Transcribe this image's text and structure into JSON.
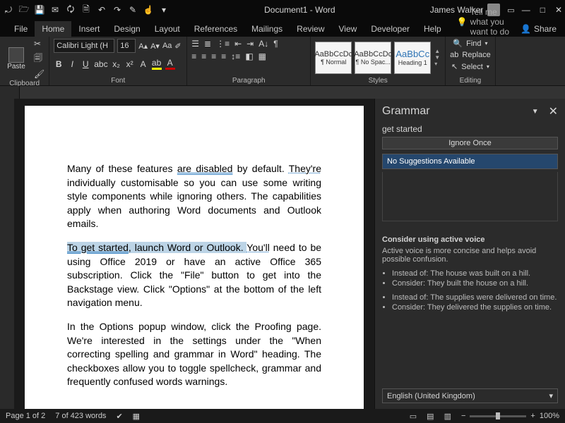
{
  "title": "Document1 - Word",
  "user": "James Walker",
  "tabs": [
    "File",
    "Home",
    "Insert",
    "Design",
    "Layout",
    "References",
    "Mailings",
    "Review",
    "View",
    "Developer",
    "Help"
  ],
  "active_tab": "Home",
  "tell_me": "Tell me what you want to do",
  "share": "Share",
  "ribbon": {
    "clipboard": {
      "paste": "Paste",
      "label": "Clipboard"
    },
    "font": {
      "name": "Calibri Light (H",
      "size": "16",
      "label": "Font"
    },
    "paragraph": {
      "label": "Paragraph"
    },
    "styles": {
      "label": "Styles",
      "s1_sample": "AaBbCcDc",
      "s1_name": "¶ Normal",
      "s2_sample": "AaBbCcDc",
      "s2_name": "¶ No Spac...",
      "s3_sample": "AaBbCc",
      "s3_name": "Heading 1"
    },
    "editing": {
      "find": "Find",
      "replace": "Replace",
      "select": "Select",
      "label": "Editing"
    }
  },
  "doc": {
    "p1a": "Many of these features ",
    "p1b": "are disabled",
    "p1c": " by default. ",
    "p1d": "They're",
    "p1e": " individually customisable so you can use some writing style components while ignoring others. The capabilities apply when authoring Word documents and Outlook emails.",
    "p2a": "To get started",
    "p2b": ", launch Word or Outlook. ",
    "p2c": "You'll",
    "p2d": " need to be using Office 2019 or have an active Office 365 subscription. Click the \"File\" button to get into the Backstage view. Click \"Options\" at the bottom of the left navigation menu.",
    "p3": "In the Options popup window, click the Proofing page. We're interested in the settings under the \"When correcting spelling and grammar in Word\" heading. The checkboxes allow you to toggle spellcheck, grammar and frequently confused words warnings."
  },
  "pane": {
    "title": "Grammar",
    "issue": "get started",
    "ignore": "Ignore Once",
    "nosug": "No Suggestions Available",
    "advice_title": "Consider using active voice",
    "advice_body": "Active voice is more concise and helps avoid possible confusion.",
    "ex1a": "Instead of: The house was built on a hill.",
    "ex1b": "Consider: They built the house on a hill.",
    "ex2a": "Instead of: The supplies were delivered on time.",
    "ex2b": "Consider: They delivered the supplies on time.",
    "language": "English (United Kingdom)"
  },
  "status": {
    "page": "Page 1 of 2",
    "words": "7 of 423 words",
    "zoom": "100%"
  }
}
